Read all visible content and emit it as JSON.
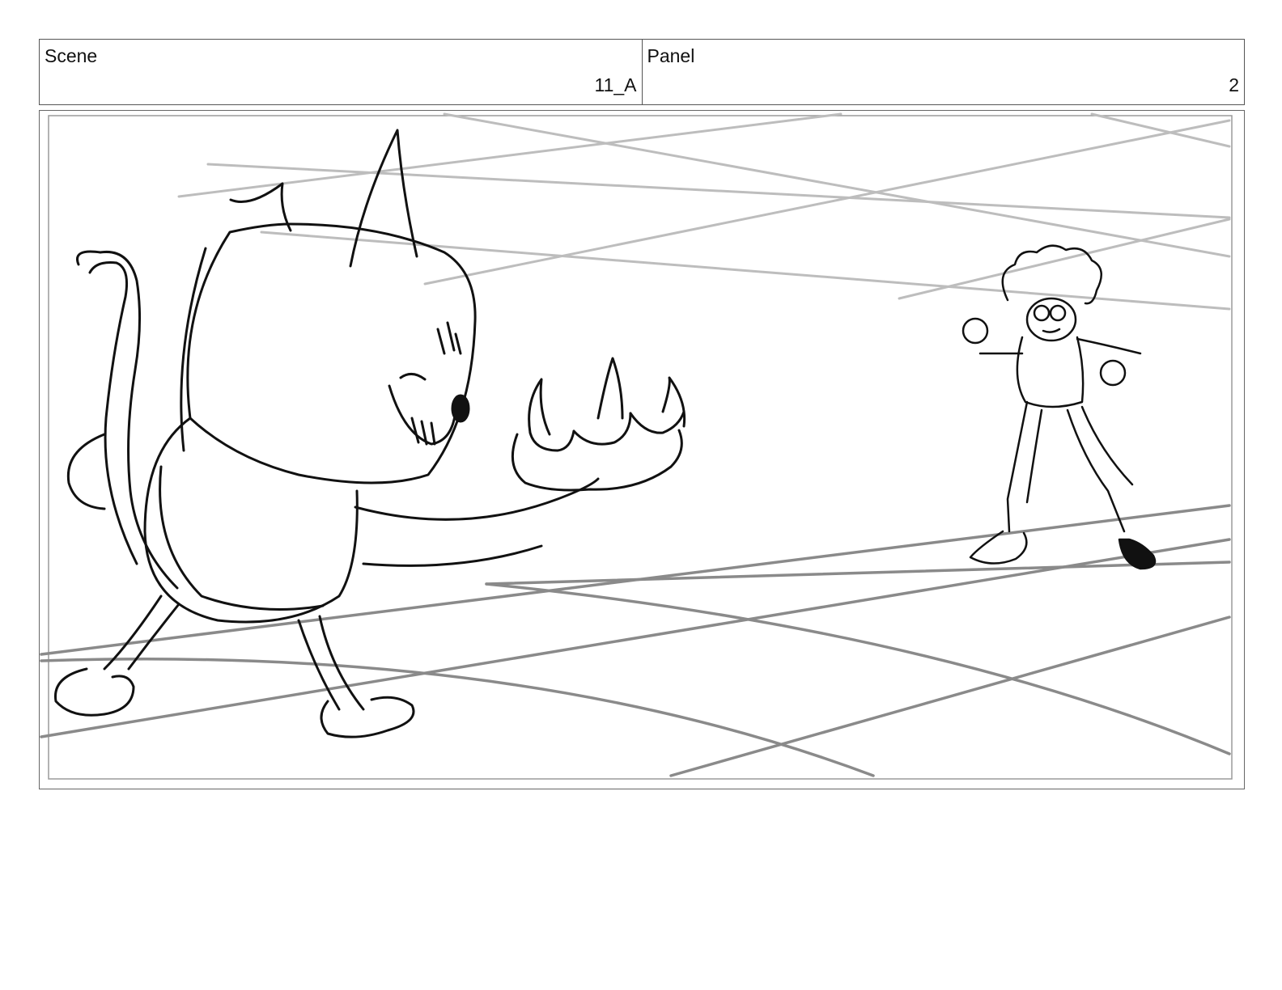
{
  "scene": {
    "label": "Scene",
    "value": "11_A"
  },
  "panel": {
    "label": "Panel",
    "value": "2"
  },
  "artwork": {
    "subject": "storyboard sketch: cartoon cat creature reaching a clawed paw toward a curly-haired character on a perspective grid floor",
    "line_color": "#111111",
    "grid_color": "#8a8a8a",
    "upper_grid_color": "#bdbdbd"
  }
}
